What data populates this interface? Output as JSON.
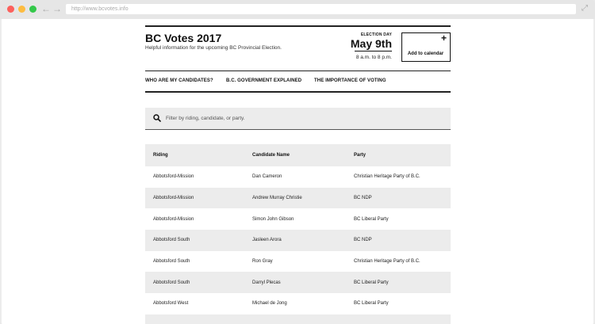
{
  "browser": {
    "url": "http://www.bcvotes.info"
  },
  "header": {
    "title": "BC Votes 2017",
    "subtitle": "Helpful information for the upcoming BC Provincial Election.",
    "election_label": "ELECTION DAY",
    "election_date": "May 9th",
    "election_time": "8 a.m. to 8 p.m.",
    "calendar_plus": "+",
    "calendar_label": "Add to calendar"
  },
  "nav": {
    "items": [
      {
        "label": "WHO ARE MY CANDIDATES?"
      },
      {
        "label": "B.C. GOVERNMENT EXPLAINED"
      },
      {
        "label": "THE IMPORTANCE OF VOTING"
      }
    ]
  },
  "search": {
    "placeholder": "Filter by riding, candidate, or party.",
    "icon": "search-icon"
  },
  "table": {
    "headers": [
      "Riding",
      "Candidate Name",
      "Party"
    ],
    "rows": [
      [
        "Abbotsford-Mission",
        "Dan Cameron",
        "Christian Heritage Party of B.C."
      ],
      [
        "Abbotsford-Mission",
        "Andrew Murray Christie",
        "BC NDP"
      ],
      [
        "Abbotsford-Mission",
        "Simon John Gibson",
        "BC Liberal Party"
      ],
      [
        "Abbotsford South",
        "Jasleen Arora",
        "BC NDP"
      ],
      [
        "Abbotsford South",
        "Ron Gray",
        "Christian Heritage Party of B.C."
      ],
      [
        "Abbotsford South",
        "Darryl Plecas",
        "BC Liberal Party"
      ],
      [
        "Abbotsford West",
        "Michael de Jong",
        "BC Liberal Party"
      ]
    ]
  },
  "colors": {
    "accent": "#222222",
    "row_alt": "#ececec"
  }
}
